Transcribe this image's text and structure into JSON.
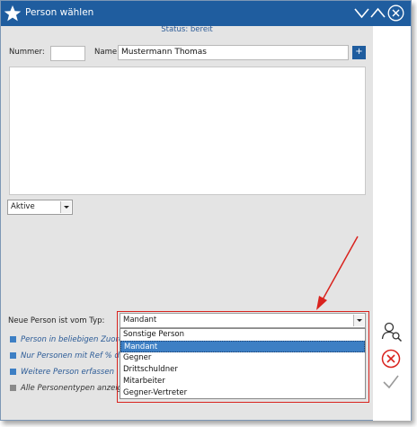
{
  "window": {
    "title": "Person wählen"
  },
  "status": "Status: bereit",
  "form": {
    "nummer_label": "Nummer:",
    "nummer_value": "",
    "name_label": "Name",
    "name_value": "Mustermann Thomas",
    "add_label": "+"
  },
  "filter": {
    "selected": "Aktive"
  },
  "new_person": {
    "label": "Neue Person ist vom Typ:",
    "selected": "Mandant",
    "options": [
      "Sonstige Person",
      "Mandant",
      "Gegner",
      "Drittschuldner",
      "Mitarbeiter",
      "Gegner-Vertreter"
    ],
    "highlighted_index": 1
  },
  "options": [
    {
      "label": "Person in beliebigen Zuordnu",
      "checked": true
    },
    {
      "label": "Nur Personen mit Ref % des U",
      "checked": true
    },
    {
      "label": "Weitere Person erfassen",
      "checked": true
    },
    {
      "label": "Alle Personentypen  anzeigen",
      "checked": false
    }
  ],
  "colors": {
    "titlebar": "#1f5d9f",
    "accent": "#3d7fc4",
    "annotation": "#d9231e"
  }
}
